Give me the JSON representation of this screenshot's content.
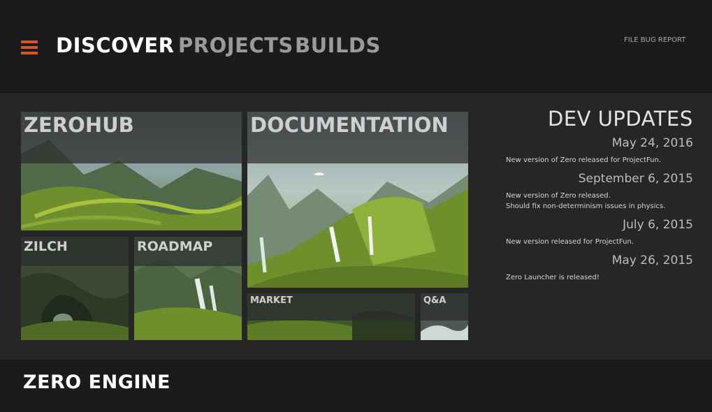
{
  "window": {
    "minimize": "_",
    "maximize": "□",
    "close": "✕",
    "close_color": "#c7402a"
  },
  "header": {
    "nav": [
      "DISCOVER",
      "PROJECTS",
      "BUILDS"
    ],
    "bug_report": "FILE BUG REPORT",
    "accent_color": "#d9572f"
  },
  "tiles": {
    "zerohub": "ZEROHUB",
    "documentation": "DOCUMENTATION",
    "zilch": "ZILCH",
    "roadmap": "ROADMAP",
    "market": "MARKET",
    "qa": "Q&A"
  },
  "dev_updates": {
    "title": "DEV UPDATES",
    "items": [
      {
        "date": "May 24, 2016",
        "lines": [
          "New version of Zero released for ProjectFun."
        ]
      },
      {
        "date": "September 6, 2015",
        "lines": [
          "New version of Zero released.",
          "Should fix non-determinism issues in physics."
        ]
      },
      {
        "date": "July 6, 2015",
        "lines": [
          "New version released for ProjectFun."
        ]
      },
      {
        "date": "May 26, 2015",
        "lines": [
          "Zero Launcher is released!"
        ]
      }
    ]
  },
  "footer": {
    "title": "ZERO ENGINE"
  }
}
